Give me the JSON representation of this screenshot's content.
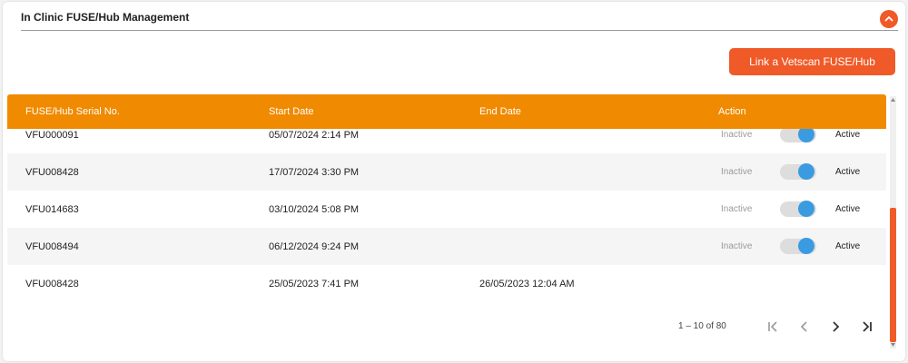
{
  "section": {
    "title": "In Clinic FUSE/Hub Management"
  },
  "link_button": {
    "label": "Link a Vetscan FUSE/Hub"
  },
  "table": {
    "headers": {
      "serial": "FUSE/Hub Serial No.",
      "start": "Start Date",
      "end": "End Date",
      "action": "Action"
    },
    "rows": [
      {
        "serial": "VFU000091",
        "start": "05/07/2024 2:14 PM",
        "end": "",
        "inactive": "Inactive",
        "active": "Active"
      },
      {
        "serial": "VFU008428",
        "start": "17/07/2024 3:30 PM",
        "end": "",
        "inactive": "Inactive",
        "active": "Active"
      },
      {
        "serial": "VFU014683",
        "start": "03/10/2024 5:08 PM",
        "end": "",
        "inactive": "Inactive",
        "active": "Active"
      },
      {
        "serial": "VFU008494",
        "start": "06/12/2024 9:24 PM",
        "end": "",
        "inactive": "Inactive",
        "active": "Active"
      },
      {
        "serial": "VFU008428",
        "start": "25/05/2023 7:41 PM",
        "end": "26/05/2023 12:04 AM"
      }
    ]
  },
  "pagination": {
    "range": "1 – 10 of 80"
  },
  "colors": {
    "accent": "#f05a28",
    "header": "#f08a00",
    "toggle_on": "#3a9be0"
  }
}
